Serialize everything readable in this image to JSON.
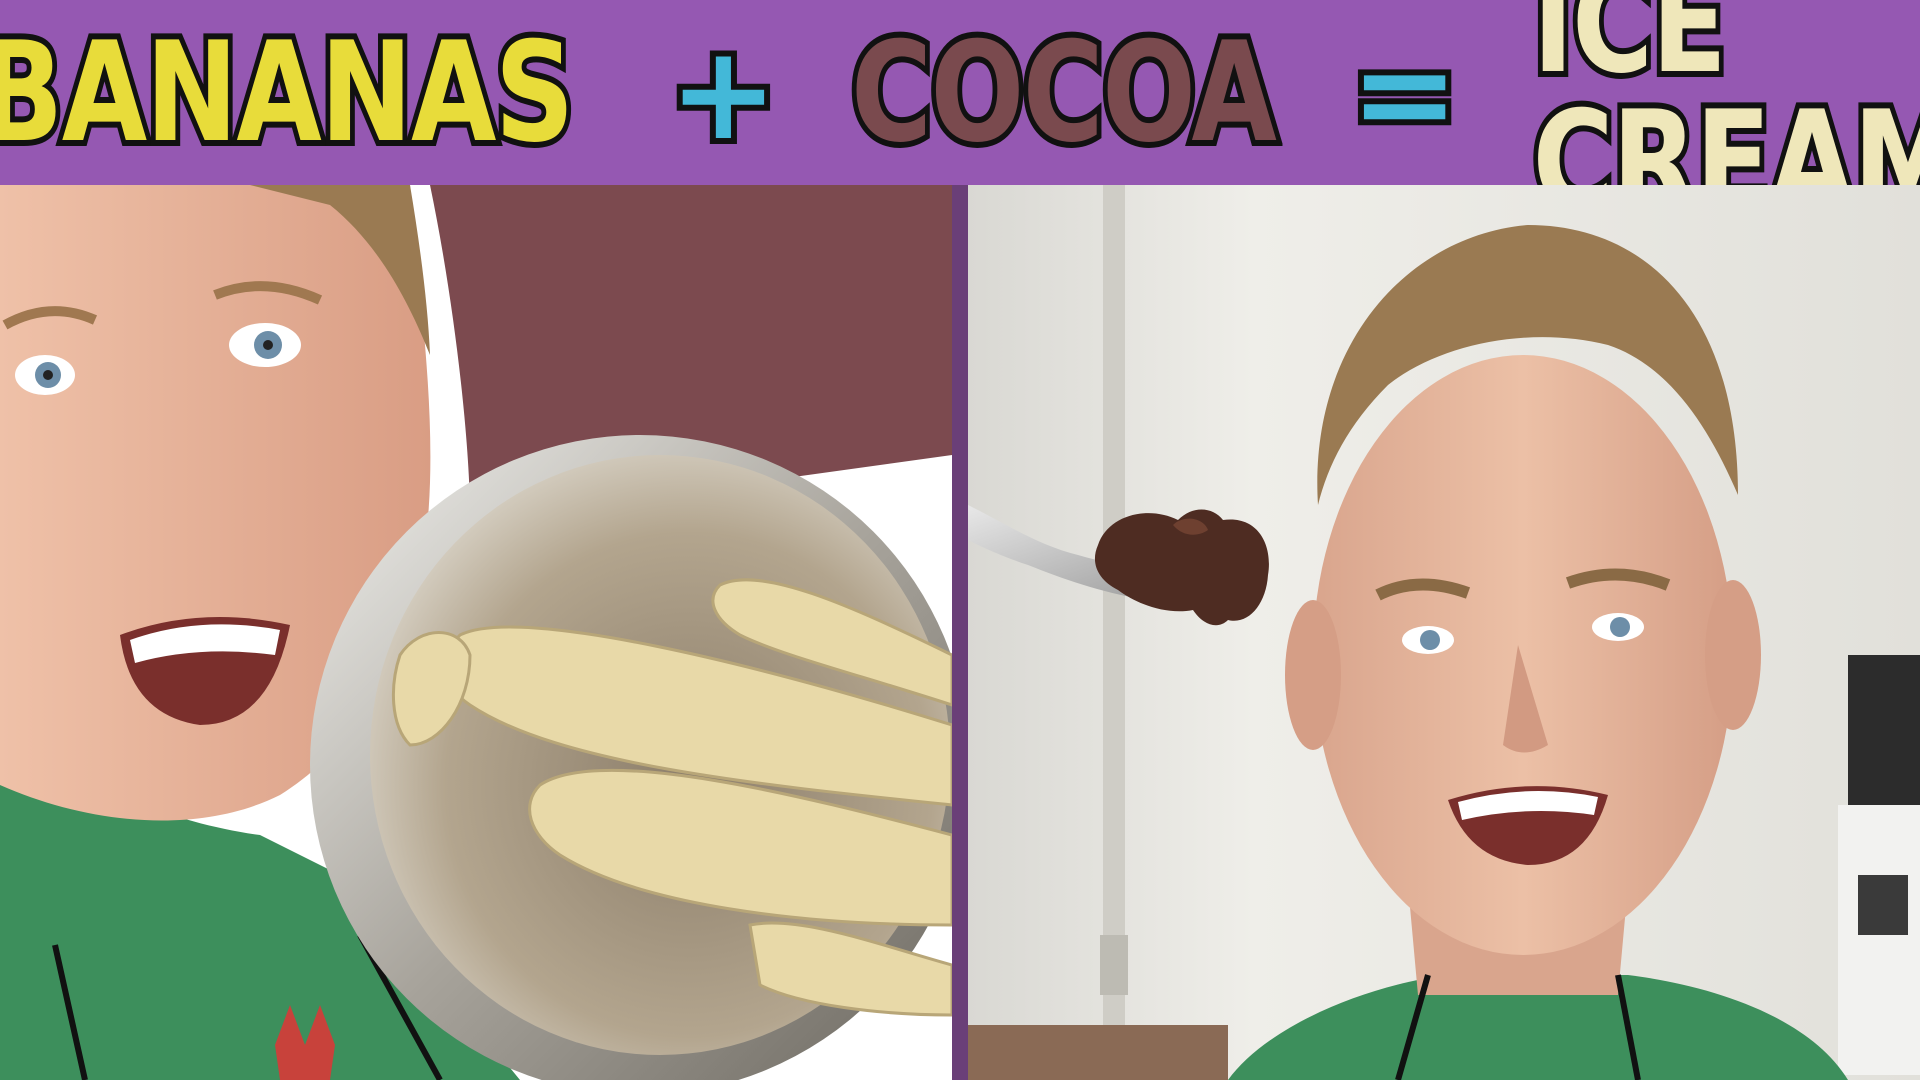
{
  "banner": {
    "words": [
      {
        "text": "BANANAS",
        "color": "#e8dc3a"
      },
      {
        "text": "+",
        "color": "#43b8d8"
      },
      {
        "text": "COCOA",
        "color": "#7a4a4e"
      },
      {
        "text": "=",
        "color": "#43b8d8"
      },
      {
        "text": "ICE CREAM",
        "color": "#efe7ba"
      }
    ],
    "background": "#9558b2"
  },
  "colors": {
    "divider": "#6a3f78",
    "left_backdrop": "#7c4a4f",
    "shirt": "#3d8f5c",
    "skin": "#e9b49c",
    "hair": "#9a7a52",
    "bowl_metal": "#b9b2a4",
    "banana": "#e8d9a8",
    "wall": "#e6e4de",
    "cocoa_ice_cream": "#4e2c22"
  }
}
